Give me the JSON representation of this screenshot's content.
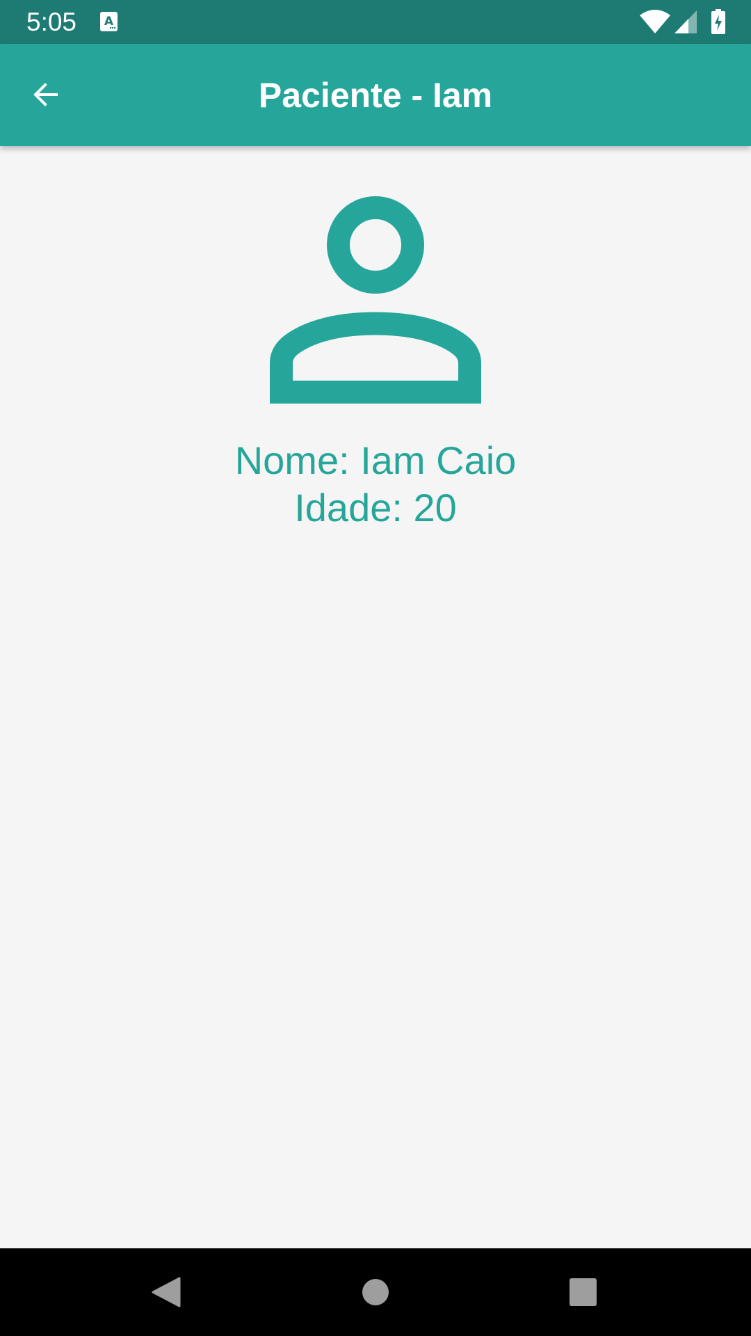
{
  "status_bar": {
    "time": "5:05",
    "icons": [
      "a-keyboard-icon",
      "wifi-icon",
      "signal-icon",
      "battery-charging-icon"
    ]
  },
  "app_bar": {
    "back_icon": "arrow-back-icon",
    "title": "Paciente - Iam"
  },
  "patient": {
    "avatar_icon": "person-outline-icon",
    "name_line": "Nome: Iam Caio",
    "age_line": "Idade: 20"
  },
  "nav_bar": {
    "icons": [
      "nav-back-icon",
      "nav-home-icon",
      "nav-recents-icon"
    ]
  },
  "colors": {
    "status_bar": "#1e7b74",
    "app_bar": "#26a69a",
    "accent": "#26a69a",
    "background": "#f5f5f5",
    "nav_bar": "#000000",
    "nav_icons": "#9e9e9e"
  }
}
